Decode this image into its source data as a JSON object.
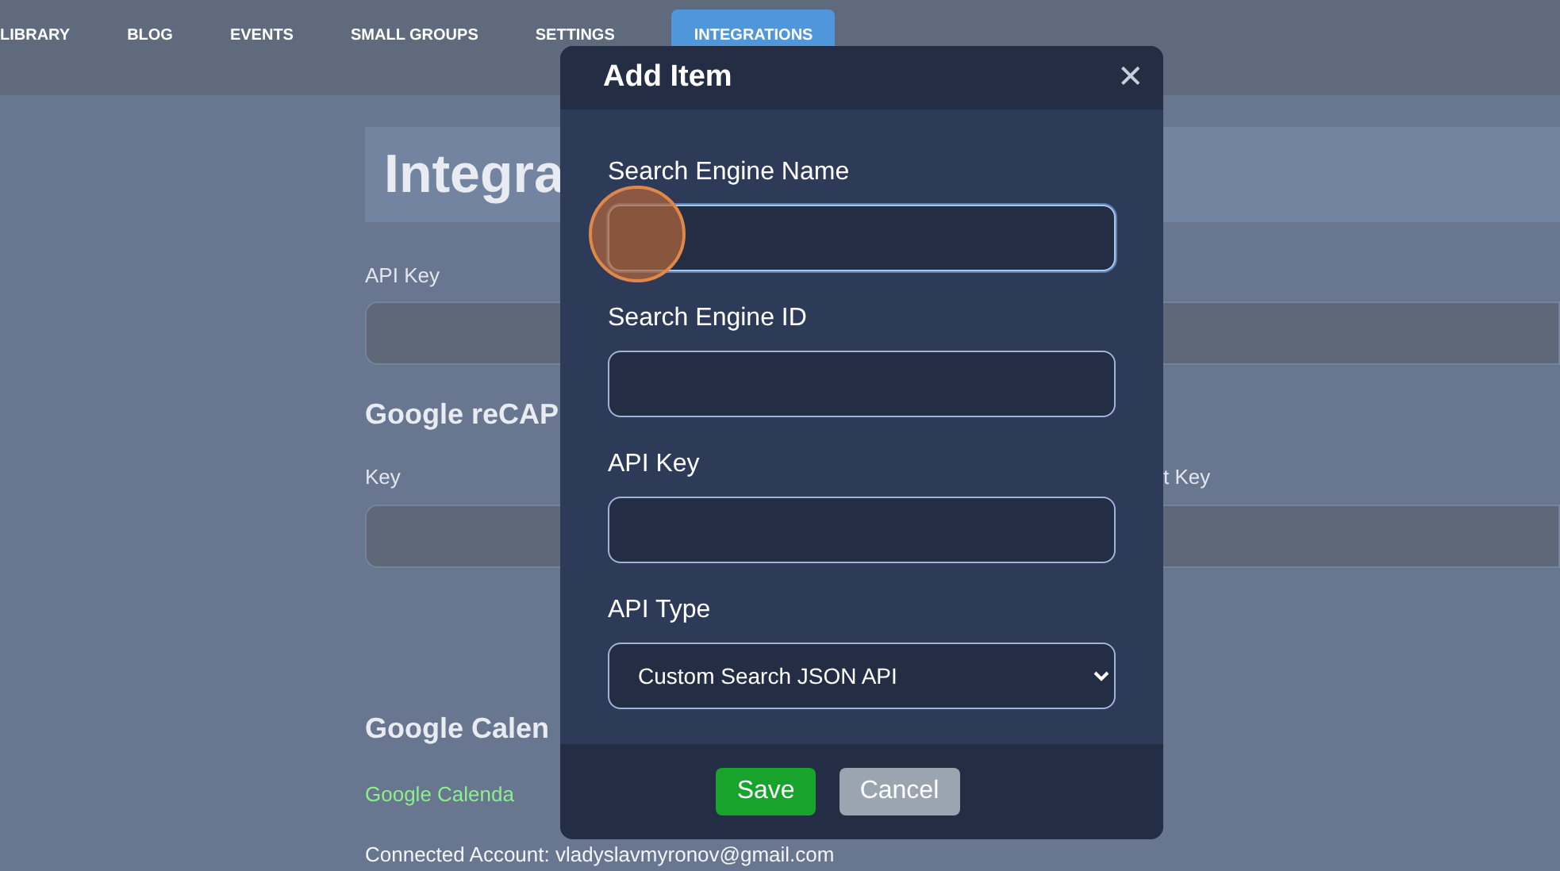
{
  "nav": {
    "items": [
      {
        "label": "LIBRARY",
        "selected": false
      },
      {
        "label": "BLOG",
        "selected": false
      },
      {
        "label": "EVENTS",
        "selected": false
      },
      {
        "label": "SMALL GROUPS",
        "selected": false
      },
      {
        "label": "SETTINGS",
        "selected": false
      },
      {
        "label": "INTEGRATIONS",
        "selected": true
      }
    ]
  },
  "page": {
    "heading": "Integra",
    "api_key_label": "API Key",
    "recaptcha_heading": "Google reCAP",
    "key_label": "Key",
    "secret_key_label": "t Key",
    "calendar_heading": "Google Calen",
    "calendar_status": "Google Calenda",
    "connected_account": "Connected Account: vladyslavmyronov@gmail.com"
  },
  "dialog": {
    "title": "Add Item",
    "close": "✕",
    "fields": [
      {
        "kind": "text",
        "label": "Search Engine Name",
        "focused": true
      },
      {
        "kind": "text",
        "label": "Search Engine ID",
        "focused": false
      },
      {
        "kind": "text",
        "label": "API Key",
        "focused": false
      },
      {
        "kind": "select",
        "label": "API Type",
        "value": "Custom Search JSON API"
      }
    ],
    "buttons": [
      {
        "kind": "primary",
        "label": "Save"
      },
      {
        "kind": "secondary",
        "label": "Cancel"
      }
    ]
  }
}
